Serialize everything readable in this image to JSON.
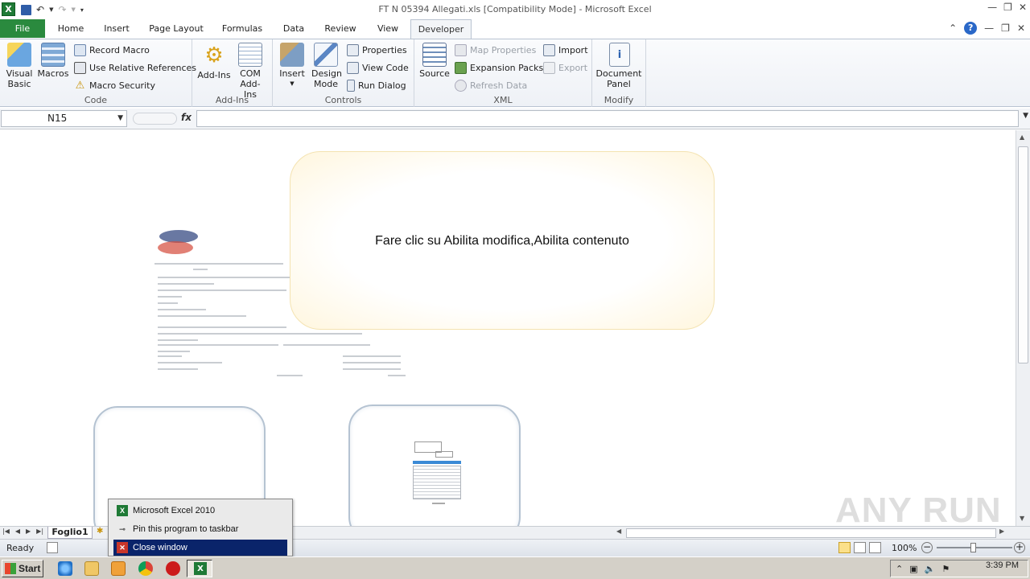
{
  "window": {
    "title": "FT N 05394 Allegati.xls  [Compatibility Mode]  -  Microsoft Excel"
  },
  "tabs": [
    "File",
    "Home",
    "Insert",
    "Page Layout",
    "Formulas",
    "Data",
    "Review",
    "View",
    "Developer"
  ],
  "active_tab": "Developer",
  "ribbon": {
    "code": {
      "label": "Code",
      "visual_basic": "Visual Basic",
      "macros": "Macros",
      "record_macro": "Record Macro",
      "use_relative_references": "Use Relative References",
      "macro_security": "Macro Security"
    },
    "addins": {
      "label": "Add-Ins",
      "add_ins": "Add-Ins",
      "com_add_ins": "COM Add-Ins"
    },
    "controls": {
      "label": "Controls",
      "insert": "Insert",
      "design_mode": "Design Mode",
      "properties": "Properties",
      "view_code": "View Code",
      "run_dialog": "Run Dialog"
    },
    "xml": {
      "label": "XML",
      "source": "Source",
      "map_properties": "Map Properties",
      "expansion_packs": "Expansion Packs",
      "refresh_data": "Refresh Data",
      "import": "Import",
      "export": "Export"
    },
    "modify": {
      "label": "Modify",
      "document_panel": "Document Panel"
    }
  },
  "formula_bar": {
    "name_box": "N15",
    "fx": "fx",
    "value": ""
  },
  "sheet": {
    "popup_text": "Fare clic su Abilita modifica,Abilita contenuto",
    "tab_name": "Foglio1"
  },
  "status": {
    "ready": "Ready",
    "zoom": "100%",
    "zoom_level_fraction": 0.5
  },
  "jumplist": {
    "items": [
      "Microsoft Excel 2010",
      "Pin this program to taskbar",
      "Close window"
    ]
  },
  "taskbar": {
    "start": "Start",
    "clock": "3:39 PM"
  },
  "watermark": "ANY RUN"
}
